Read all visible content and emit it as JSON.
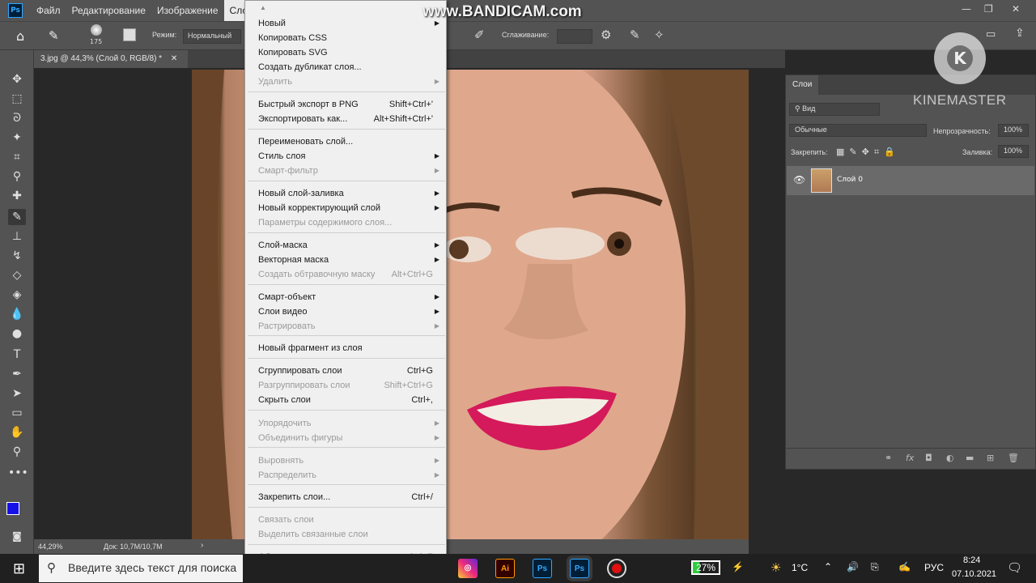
{
  "app": {
    "menu": [
      "Файл",
      "Редактирование",
      "Изображение",
      "Сло"
    ],
    "active_menu": "Сло"
  },
  "options": {
    "brush_size": "175",
    "mode_label": "Режим:",
    "mode_value": "Нормальный",
    "smoothing_label": "Сглаживание:"
  },
  "document": {
    "tab_title": "3.jpg @ 44,3% (Слой 0, RGB/8) *",
    "zoom": "44,29%",
    "doc_size": "Док: 10,7M/10,7M"
  },
  "watermarks": {
    "bandicam": "www.BANDICAM.com",
    "kinemaster": "KINEMASTER",
    "kinemaster_letter": "K"
  },
  "layers_panel": {
    "tab": "Слои",
    "kind": "Вид",
    "blend_mode": "Обычные",
    "opacity_label": "Непрозрачность:",
    "opacity_value": "100%",
    "lock_label": "Закрепить:",
    "fill_label": "Заливка:",
    "fill_value": "100%",
    "layer_name": "Слой 0"
  },
  "dropdown": {
    "items": [
      {
        "label": "Новый",
        "shortcut": "",
        "submenu": true,
        "disabled": false
      },
      {
        "label": "Копировать CSS",
        "shortcut": "",
        "submenu": false,
        "disabled": false
      },
      {
        "label": "Копировать SVG",
        "shortcut": "",
        "submenu": false,
        "disabled": false
      },
      {
        "label": "Создать дубликат слоя...",
        "shortcut": "",
        "submenu": false,
        "disabled": false
      },
      {
        "label": "Удалить",
        "shortcut": "",
        "submenu": true,
        "disabled": true
      },
      {
        "label": "Быстрый экспорт в PNG",
        "shortcut": "Shift+Ctrl+'",
        "submenu": false,
        "disabled": false
      },
      {
        "label": "Экспортировать как...",
        "shortcut": "Alt+Shift+Ctrl+'",
        "submenu": false,
        "disabled": false
      },
      {
        "label": "Переименовать слой...",
        "shortcut": "",
        "submenu": false,
        "disabled": false
      },
      {
        "label": "Стиль слоя",
        "shortcut": "",
        "submenu": true,
        "disabled": false
      },
      {
        "label": "Смарт-фильтр",
        "shortcut": "",
        "submenu": true,
        "disabled": true
      },
      {
        "label": "Новый слой-заливка",
        "shortcut": "",
        "submenu": true,
        "disabled": false
      },
      {
        "label": "Новый корректирующий слой",
        "shortcut": "",
        "submenu": true,
        "disabled": false
      },
      {
        "label": "Параметры содержимого слоя...",
        "shortcut": "",
        "submenu": false,
        "disabled": true
      },
      {
        "label": "Слой-маска",
        "shortcut": "",
        "submenu": true,
        "disabled": false
      },
      {
        "label": "Векторная маска",
        "shortcut": "",
        "submenu": true,
        "disabled": false
      },
      {
        "label": "Создать обтравочную маску",
        "shortcut": "Alt+Ctrl+G",
        "submenu": false,
        "disabled": true
      },
      {
        "label": "Смарт-объект",
        "shortcut": "",
        "submenu": true,
        "disabled": false
      },
      {
        "label": "Слои видео",
        "shortcut": "",
        "submenu": true,
        "disabled": false
      },
      {
        "label": "Растрировать",
        "shortcut": "",
        "submenu": true,
        "disabled": true
      },
      {
        "label": "Новый фрагмент из слоя",
        "shortcut": "",
        "submenu": false,
        "disabled": false
      },
      {
        "label": "Сгруппировать слои",
        "shortcut": "Ctrl+G",
        "submenu": false,
        "disabled": false
      },
      {
        "label": "Разгруппировать слои",
        "shortcut": "Shift+Ctrl+G",
        "submenu": false,
        "disabled": true
      },
      {
        "label": "Скрыть слои",
        "shortcut": "Ctrl+,",
        "submenu": false,
        "disabled": false
      },
      {
        "label": "Упорядочить",
        "shortcut": "",
        "submenu": true,
        "disabled": true
      },
      {
        "label": "Объединить фигуры",
        "shortcut": "",
        "submenu": true,
        "disabled": true
      },
      {
        "label": "Выровнять",
        "shortcut": "",
        "submenu": true,
        "disabled": true
      },
      {
        "label": "Распределить",
        "shortcut": "",
        "submenu": true,
        "disabled": true
      },
      {
        "label": "Закрепить слои...",
        "shortcut": "Ctrl+/",
        "submenu": false,
        "disabled": false
      },
      {
        "label": "Связать слои",
        "shortcut": "",
        "submenu": false,
        "disabled": true
      },
      {
        "label": "Выделить связанные слои",
        "shortcut": "",
        "submenu": false,
        "disabled": true
      },
      {
        "label": "Объединить слои",
        "shortcut": "Ctrl+E",
        "submenu": false,
        "disabled": true
      }
    ]
  },
  "taskbar": {
    "search_placeholder": "Введите здесь текст для поиска",
    "battery": "27%",
    "temperature": "1°C",
    "language": "РУС",
    "time": "8:24",
    "date": "07.10.2021",
    "app_ai": "Ai",
    "app_ps": "Ps"
  }
}
